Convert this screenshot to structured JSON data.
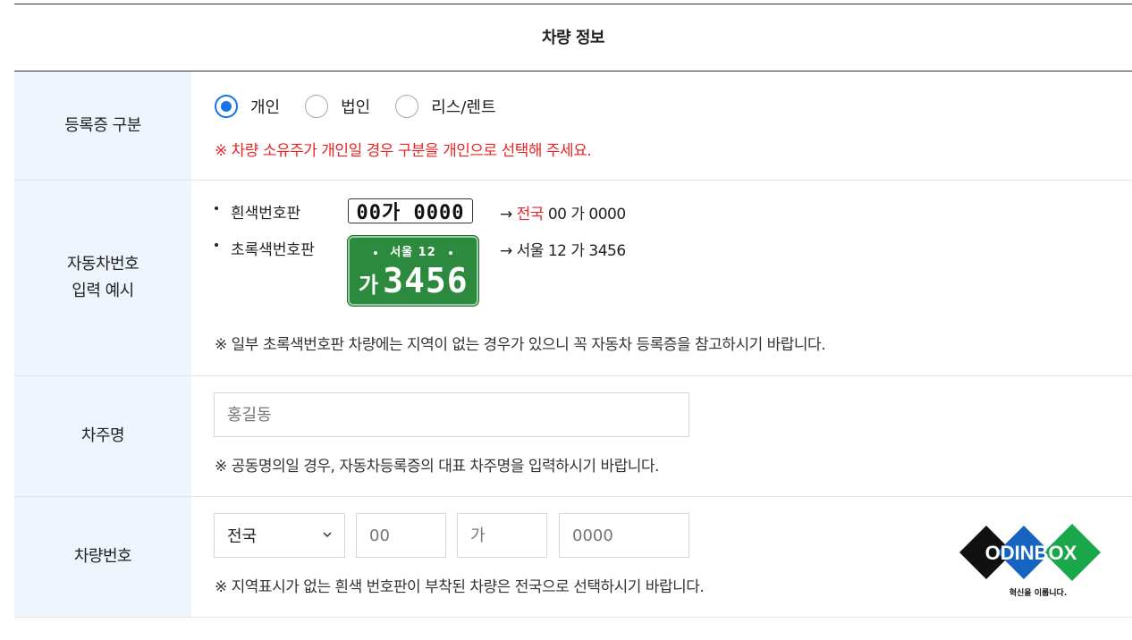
{
  "section_title": "차량 정보",
  "registration": {
    "label": "등록증 구분",
    "options": [
      "개인",
      "법인",
      "리스/렌트"
    ],
    "selected": "개인",
    "warning": "※ 차량 소유주가 개인일 경우 구분을 개인으로 선택해 주세요."
  },
  "plate_example": {
    "label_line1": "자동차번호",
    "label_line2": "입력 예시",
    "white": {
      "name": "흰색번호판",
      "plate_text": "00가 0000",
      "arrow": "→",
      "region": "전국",
      "result": " 00 가 0000"
    },
    "green": {
      "name": "초록색번호판",
      "plate_top": "서울 12",
      "plate_ga": "가",
      "plate_num": "3456",
      "arrow": "→",
      "result": " 서울 12 가 3456"
    },
    "note": "※ 일부 초록색번호판 차량에는 지역이 없는 경우가 있으니 꼭 자동차 등록증을 참고하시기 바랍니다."
  },
  "owner": {
    "label": "차주명",
    "placeholder": "홍길동",
    "note": "※ 공동명의일 경우, 자동차등록증의 대표 차주명을 입력하시기 바랍니다."
  },
  "car_number": {
    "label": "차량번호",
    "region_select": "전국",
    "placeholder_digits": "00",
    "placeholder_char": "가",
    "placeholder_number": "0000",
    "note": "※ 지역표시가 없는 흰색 번호판이 부착된 차량은 전국으로 선택하시기 바랍니다."
  },
  "logo": {
    "name": "ODINBOX",
    "tagline": "혁신을 이룹니다"
  },
  "colors": {
    "accent_blue": "#1a73e8",
    "warning_red": "#e8262a",
    "label_bg": "#eef5fc",
    "plate_green": "#2b8a3e"
  }
}
